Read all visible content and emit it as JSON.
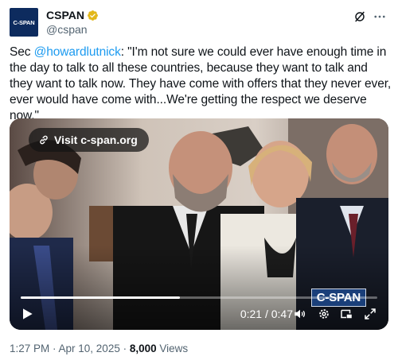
{
  "author": {
    "avatar_text": "C-SPAN",
    "display_name": "CSPAN",
    "handle": "@cspan",
    "verified_color": "#e2b719"
  },
  "header_icons": [
    "grok-icon",
    "more-icon"
  ],
  "tweet": {
    "prefix": "Sec ",
    "mention": "@howardlutnick",
    "body": ": \"I'm not sure we could ever have enough time in the day to talk to all these countries, because they want to talk and they want to talk now. They have come with offers that they never ever, ever would have come with...We're getting the respect we deserve now.\""
  },
  "media": {
    "visit_label": "Visit c-span.org",
    "watermark": "C-SPAN",
    "time_display": "0:21 / 0:47",
    "progress_fraction": 0.447,
    "controls": [
      "play-icon",
      "volume-icon",
      "settings-icon",
      "picture-in-picture-icon",
      "fullscreen-icon"
    ]
  },
  "meta": {
    "timestamp": "1:27 PM · Apr 10, 2025",
    "separator": " · ",
    "views_count": "8,000",
    "views_label": " Views"
  },
  "colors": {
    "link": "#1d9bf0",
    "secondary_text": "#536471",
    "avatar_bg": "#0d2b5e"
  }
}
